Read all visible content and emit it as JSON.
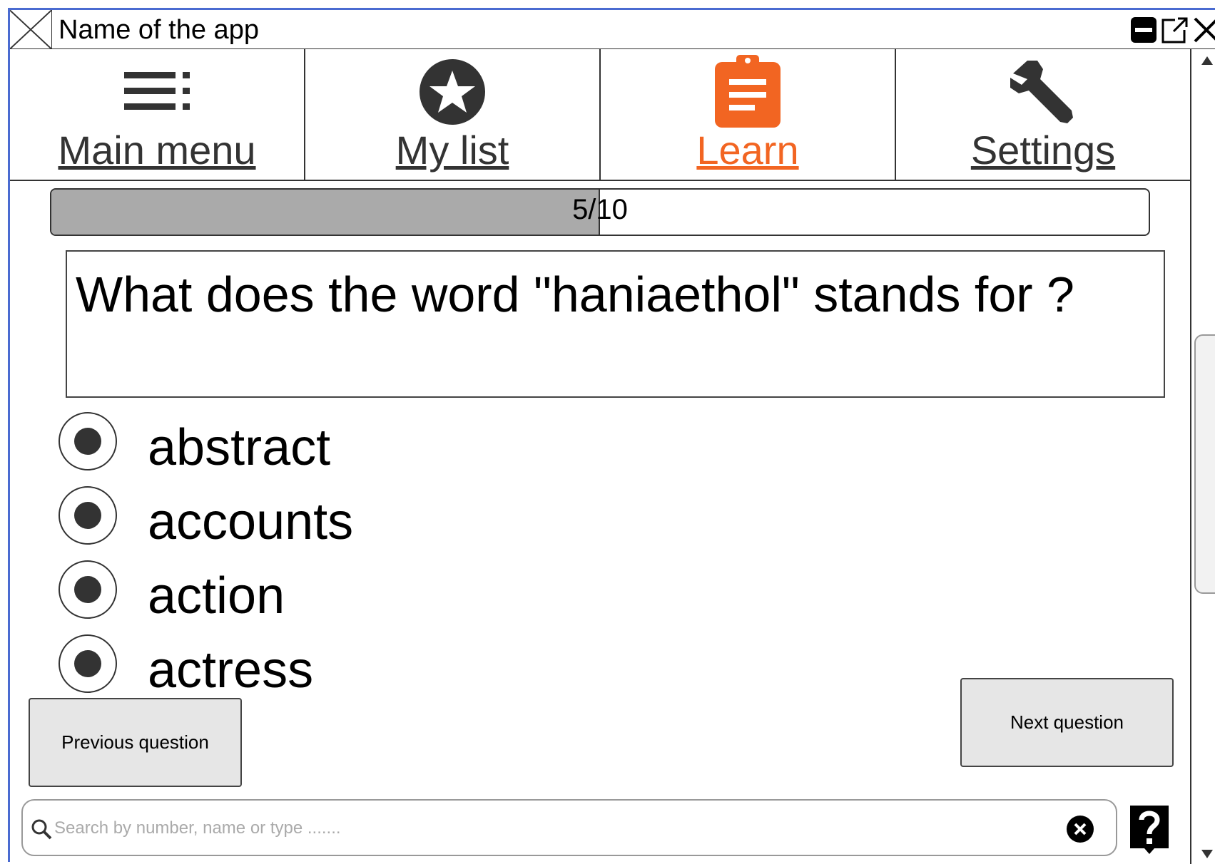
{
  "window": {
    "title": "Name of the app"
  },
  "nav": {
    "tabs": [
      {
        "label": "Main menu",
        "icon": "list-icon",
        "active": false
      },
      {
        "label": "My list",
        "icon": "star-icon",
        "active": false
      },
      {
        "label": "Learn",
        "icon": "clipboard-icon",
        "active": true
      },
      {
        "label": "Settings",
        "icon": "wrench-icon",
        "active": false
      }
    ],
    "active_color": "#f26522"
  },
  "progress": {
    "text": "5/10",
    "current": 5,
    "total": 10
  },
  "question": {
    "text": "What does the word \"haniaethol\" stands for ?"
  },
  "options": [
    {
      "label": "abstract"
    },
    {
      "label": "accounts"
    },
    {
      "label": "action"
    },
    {
      "label": "actress"
    }
  ],
  "buttons": {
    "previous": "Previous question",
    "next": "Next question"
  },
  "search": {
    "placeholder": "Search by number, name or type .......",
    "value": ""
  }
}
